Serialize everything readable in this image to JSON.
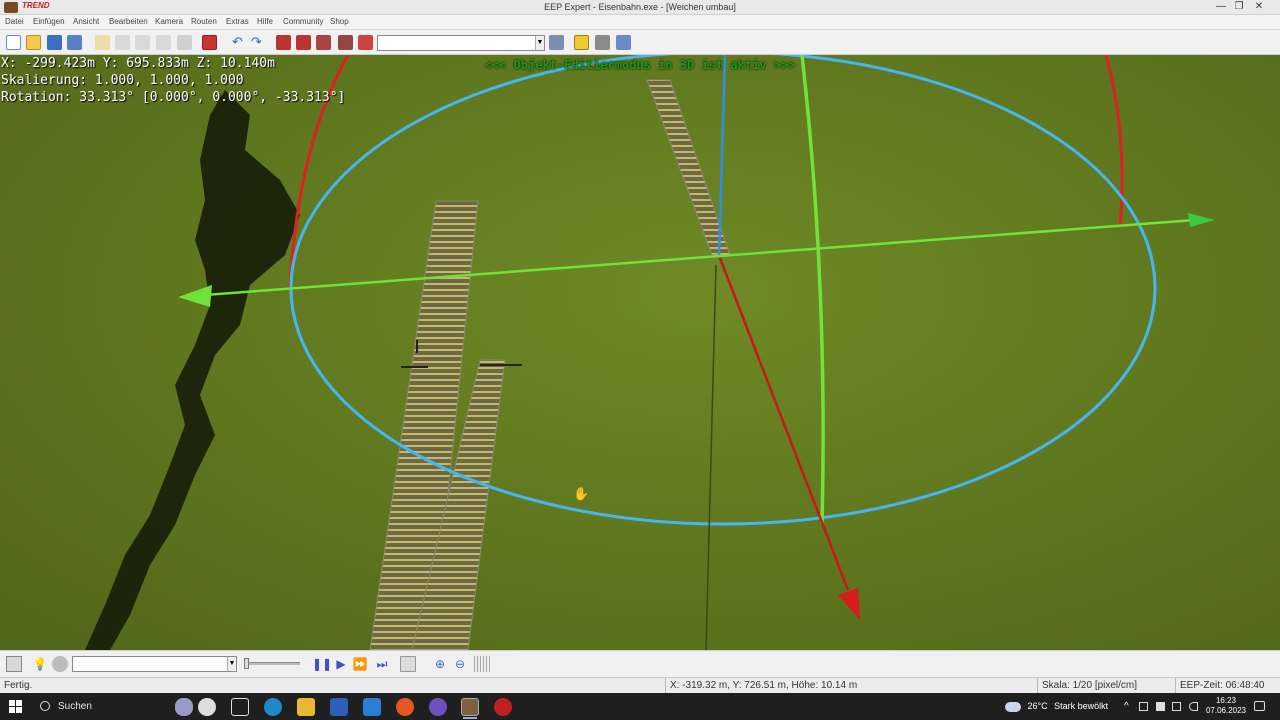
{
  "window": {
    "brand": "TREND",
    "title": "EEP Expert - Eisenbahn.exe - [Weichen umbau]",
    "controls": {
      "minimize": "—",
      "restore": "❐",
      "close": "✕"
    }
  },
  "menu": [
    "Datei",
    "Einfügen",
    "Ansicht",
    "Bearbeiten",
    "Kamera",
    "Routen",
    "Extras",
    "Hilfe",
    "Community",
    "Shop"
  ],
  "toolbar": {
    "combo_value": "",
    "combo_arrow": "▼"
  },
  "overlay": {
    "position": "X: -299.423m  Y: 695.833m  Z: 10.140m",
    "scale": "Skalierung: 1.000, 1.000, 1.000",
    "rotation": "Rotation: 33.313° [0.000°, 0.000°, -33.313°]",
    "mode_banner": "<<<  Objekt-Editiermodus in 3D ist aktiv  >>>"
  },
  "bottombar": {
    "combo_value": "",
    "combo_arrow": "▼",
    "slider_position": 0.0
  },
  "statusbar": {
    "state": "Fertig.",
    "cursor_position": "X: -319.32 m, Y: 726.51 m, Höhe: 10.14 m",
    "scale": "Skala: 1/20 [pixel/cm]",
    "eep_time": "EEP-Zeit: 06:48:40"
  },
  "taskbar": {
    "search_label": "Suchen",
    "weather_temp": "26°C",
    "weather_text": "Stark bewölkt",
    "time": "16:23",
    "date": "07.06.2023",
    "tray_chevron": "^"
  },
  "colors": {
    "ring": "#45b6f2",
    "axis_x": "#e02020",
    "axis_y": "#6fe33a",
    "axis_z": "#2f8ee8",
    "terrain": "#61791f",
    "banner": "#1a9a1a"
  }
}
